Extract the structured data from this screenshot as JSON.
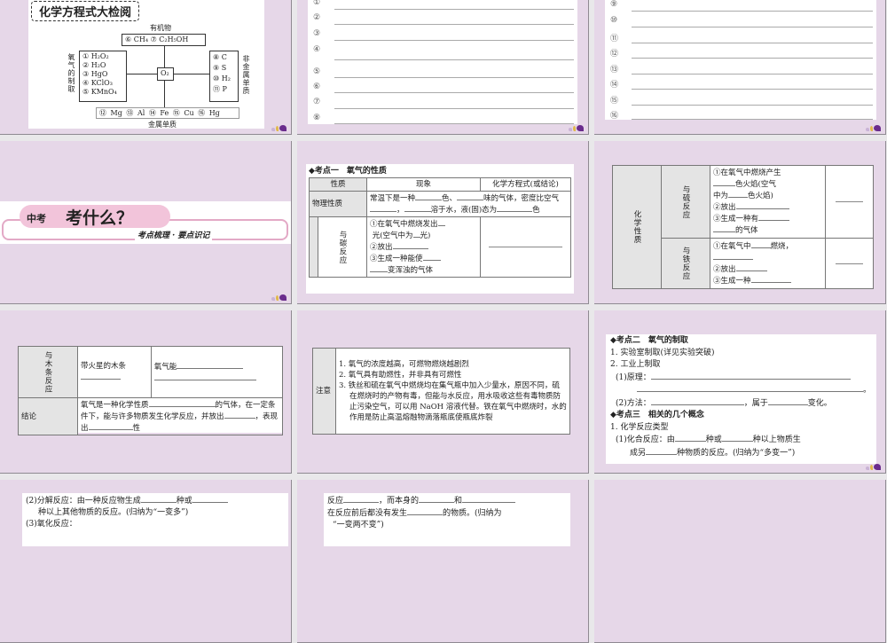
{
  "slide1": {
    "title": "化学方程式大检阅",
    "center": "O₂",
    "top_label": "有机物",
    "top_items": [
      "⑥ CH₄",
      "⑦ C₂H₅OH"
    ],
    "left_label": "氧气的制取",
    "left_items": [
      "① H₂O₂",
      "② H₂O",
      "③ HgO",
      "④ KClO₃",
      "⑤ KMnO₄"
    ],
    "right_label": "非金属单质",
    "right_items": [
      "⑧ C",
      "⑨ S",
      "⑩ H₂",
      "⑪ P"
    ],
    "bottom_label": "金属单质",
    "bottom_items": [
      "⑫ Mg",
      "⑬ Al",
      "⑭ Fe",
      "⑮ Cu",
      "⑯ Hg"
    ]
  },
  "slide2": {
    "numbers": [
      "①",
      "②",
      "③",
      "④",
      "⑤",
      "⑥",
      "⑦",
      "⑧"
    ]
  },
  "slide3": {
    "numbers": [
      "⑨",
      "⑩",
      "⑪",
      "⑫",
      "⑬",
      "⑭",
      "⑮",
      "⑯"
    ]
  },
  "slide4": {
    "pre": "中考",
    "main": "考什么？",
    "subtitle": "考点梳理 · 要点识记"
  },
  "slide5": {
    "heading": "考点一　氧气的性质",
    "headers": [
      "性质",
      "现象",
      "化学方程式(或结论)"
    ],
    "phys_label": "物理性质",
    "phys_parts": [
      "常温下是一种",
      "色、",
      "味的气体，密度比空气",
      "，",
      "溶于水，液(固)态为",
      "色"
    ],
    "carbon_label": "与碳反应",
    "carbon_lines": [
      "①在氧气中燃烧发出",
      "光(空气中为",
      "光)",
      "②放出",
      "③生成一种能使",
      "变浑浊的气体"
    ]
  },
  "slide6": {
    "chem_label": "化学性质",
    "sulfur_label": "与硫反应",
    "sulfur_lines": [
      "①在氧气中燃烧产生",
      "色火焰(空气",
      "中为",
      "色火焰)",
      "②放出",
      "③生成一种有",
      "的气体"
    ],
    "iron_label": "与铁反应",
    "iron_lines": [
      "①在氧气中",
      "燃烧，",
      "②放出",
      "③生成一种"
    ]
  },
  "slide7": {
    "wood_label": "与木条反应",
    "wood_phen": "带火星的木条",
    "wood_result": "氧气能",
    "concl_label": "结论",
    "concl_parts": [
      "氧气是一种化学性质",
      "的气体，在一定条件下，能与许多物质发生化学反应，并放出",
      "，表现出",
      "性"
    ]
  },
  "slide8": {
    "label": "注意",
    "items": [
      "1. 氧气的浓度越高，可燃物燃烧越剧烈",
      "2. 氧气具有助燃性，并非具有可燃性",
      "3. 铁丝和硫在氧气中燃烧均在集气瓶中加入少量水，原因不同，硫在燃烧时的产物有毒，但能与水反应，用水吸收这些有毒物质防止污染空气，可以用 NaOH 溶液代替。铁在氧气中燃烧时，水的作用是防止高温熔融物滴落瓶底使瓶底炸裂"
    ]
  },
  "slide9": {
    "heading2": "考点二　氧气的制取",
    "l1": "1. 实验室制取(详见实验突破)",
    "l2": "2. 工业上制取",
    "l3": "(1)原理：",
    "l4a": "(2)方法：",
    "l4b": "，属于",
    "l4c": "变化。",
    "heading3": "考点三　相关的几个概念",
    "l5": "1. 化学反应类型",
    "l6a": "(1)化合反应：由",
    "l6b": "种或",
    "l6c": "种以上物质生",
    "l7a": "成另",
    "l7b": "种物质的反应。(归纳为“多变一”)"
  },
  "slide10": {
    "l1a": "(2)分解反应：由一种反应物生成",
    "l1b": "种或",
    "l2": "种以上其他物质的反应。(归纳为“一变多”)",
    "l3": "(3)氧化反应："
  },
  "slide11": {
    "l1a": "反应",
    "l1b": "，而本身的",
    "l1c": "和",
    "l2a": "在反应前后都没有发生",
    "l2b": "的物质。(归纳为",
    "l3": "“一变两不变”)"
  }
}
